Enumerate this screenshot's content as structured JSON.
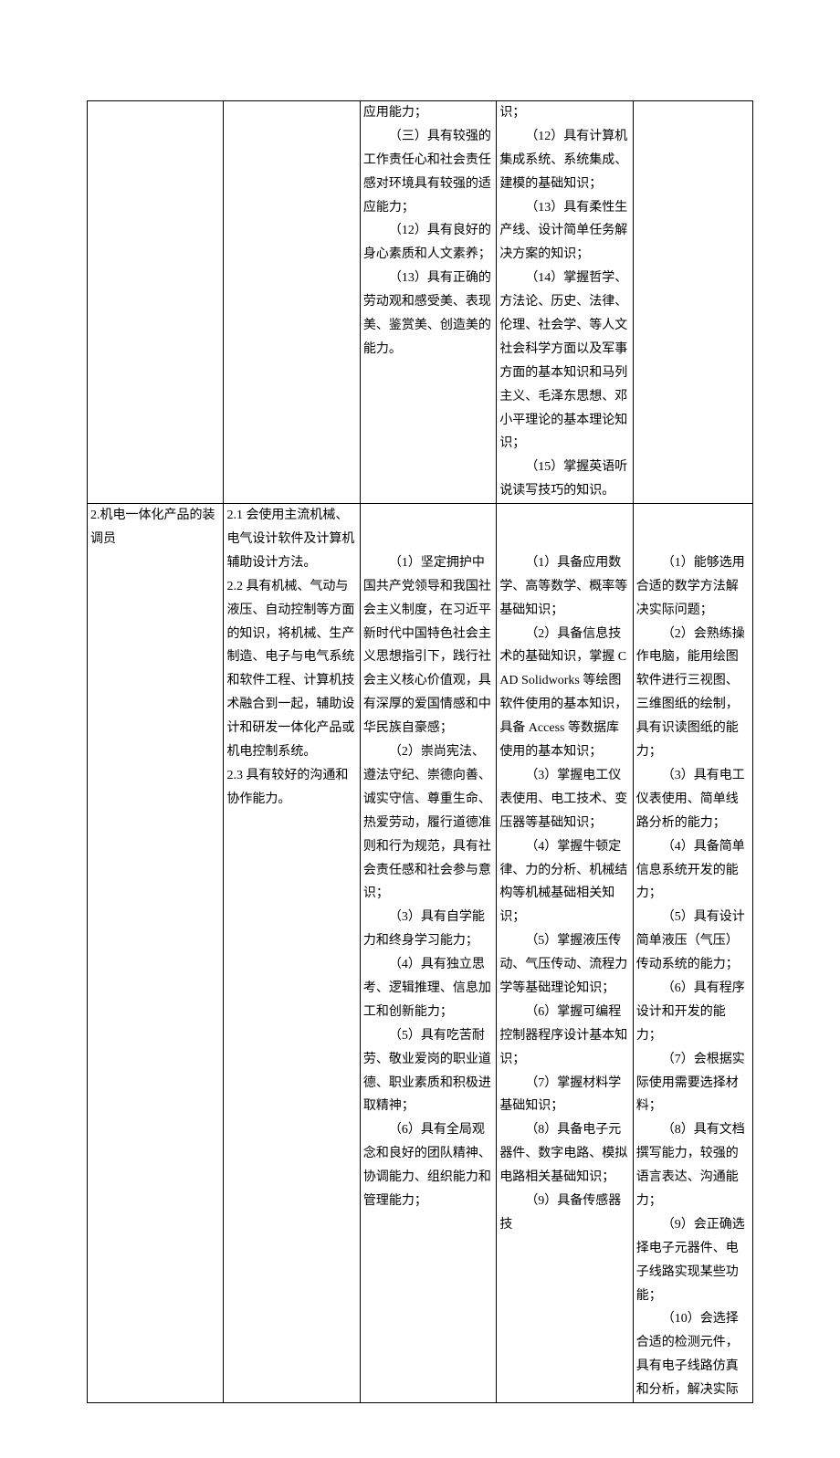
{
  "row1": {
    "col1": "",
    "col2": "",
    "col3": [
      {
        "t": "应用能力；",
        "i": false
      },
      {
        "t": "（三）具有较强的工作责任心和社会责任感对环境具有较强的适应能力；",
        "i": true
      },
      {
        "t": "（12）具有良好的身心素质和人文素养；",
        "i": true
      },
      {
        "t": "（13）具有正确的劳动观和感受美、表现美、鉴赏美、创造美的能力。",
        "i": true
      }
    ],
    "col4": [
      {
        "t": "识；",
        "i": false
      },
      {
        "t": "（12）具有计算机集成系统、系统集成、建模的基础知识；",
        "i": true
      },
      {
        "t": "（13）具有柔性生产线、设计简单任务解决方案的知识；",
        "i": true
      },
      {
        "t": "（14）掌握哲学、方法论、历史、法律、伦理、社会学、等人文社会科学方面以及军事方面的基本知识和马列主义、毛泽东思想、邓小平理论的基本理论知识；",
        "i": true
      },
      {
        "t": "（15）掌握英语听说读写技巧的知识。",
        "i": true
      }
    ],
    "col5": ""
  },
  "row2": {
    "col1": [
      {
        "t": "2.机电一体化产品的装调员",
        "i": false
      }
    ],
    "col2": [
      {
        "t": "2.1 会使用主流机械、电气设计软件及计算机辅助设计方法。",
        "i": false
      },
      {
        "t": "2.2 具有机械、气动与液压、自动控制等方面的知识，将机械、生产制造、电子与电气系统和软件工程、计算机技术融合到一起，辅助设计和研发一体化产品或机电控制系统。",
        "i": false
      },
      {
        "t": "2.3 具有较好的沟通和协作能力。",
        "i": false
      }
    ],
    "col3": [
      {
        "t": "",
        "i": false
      },
      {
        "t": "",
        "i": false
      },
      {
        "t": "（1）坚定拥护中国共产党领导和我国社会主义制度，在习近平新时代中国特色社会主义思想指引下，践行社会主义核心价值观，具有深厚的爱国情感和中华民族自豪感；",
        "i": true
      },
      {
        "t": "（2）崇尚宪法、遵法守纪、崇德向善、诚实守信、尊重生命、热爱劳动，履行道德准则和行为规范，具有社会责任感和社会参与意识；",
        "i": true
      },
      {
        "t": "（3）具有自学能力和终身学习能力；",
        "i": true
      },
      {
        "t": "（4）具有独立思考、逻辑推理、信息加工和创新能力；",
        "i": true
      },
      {
        "t": "（5）具有吃苦耐劳、敬业爱岗的职业道德、职业素质和积极进取精神；",
        "i": true
      },
      {
        "t": "（6）具有全局观念和良好的团队精神、协调能力、组织能力和管理能力；",
        "i": true
      }
    ],
    "col4": [
      {
        "t": "",
        "i": false
      },
      {
        "t": "",
        "i": false
      },
      {
        "t": "（1）具备应用数学、高等数学、概率等基础知识；",
        "i": true
      },
      {
        "t": "（2）具备信息技术的基础知识，掌握 CAD Solidworks 等绘图软件使用的基本知识，具备 Access 等数据库使用的基本知识；",
        "i": true
      },
      {
        "t": "（3）掌握电工仪表使用、电工技术、变压器等基础知识；",
        "i": true
      },
      {
        "t": "（4）掌握牛顿定律、力的分析、机械结构等机械基础相关知识；",
        "i": true
      },
      {
        "t": "（5）掌握液压传动、气压传动、流程力学等基础理论知识；",
        "i": true
      },
      {
        "t": "（6）掌握可编程控制器程序设计基本知识；",
        "i": true
      },
      {
        "t": "（7）掌握材料学基础知识；",
        "i": true
      },
      {
        "t": "（8）具备电子元器件、数字电路、模拟电路相关基础知识；",
        "i": true
      },
      {
        "t": "（9）具备传感器技",
        "i": true
      }
    ],
    "col5": [
      {
        "t": "",
        "i": false
      },
      {
        "t": "",
        "i": false
      },
      {
        "t": "（1）能够选用合适的数学方法解决实际问题；",
        "i": true
      },
      {
        "t": "（2）会熟练操作电脑，能用绘图软件进行三视图、三维图纸的绘制，具有识读图纸的能力；",
        "i": true
      },
      {
        "t": "（3）具有电工仪表使用、简单线路分析的能力；",
        "i": true
      },
      {
        "t": "（4）具备简单信息系统开发的能力；",
        "i": true
      },
      {
        "t": "（5）具有设计简单液压（气压）传动系统的能力；",
        "i": true
      },
      {
        "t": "（6）具有程序设计和开发的能力；",
        "i": true
      },
      {
        "t": "（7）会根据实际使用需要选择材料；",
        "i": true
      },
      {
        "t": "（8）具有文档撰写能力，较强的语言表达、沟通能力；",
        "i": true
      },
      {
        "t": "（9）会正确选择电子元器件、电子线路实现某些功能；",
        "i": true
      },
      {
        "t": "（10）会选择合适的检测元件，具有电子线路仿真和分析，解决实际",
        "i": true
      }
    ]
  }
}
